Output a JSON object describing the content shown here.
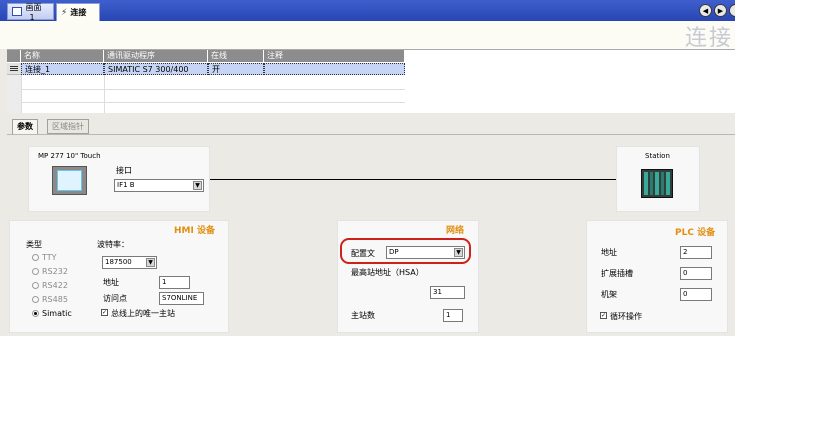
{
  "tabs": [
    {
      "label": "画面_1",
      "active": false
    },
    {
      "label": "连接",
      "active": true
    }
  ],
  "header": {
    "title": "连接"
  },
  "table": {
    "columns": [
      "名称",
      "通讯驱动程序",
      "在线",
      "注释"
    ],
    "rows": [
      {
        "name": "连接_1",
        "driver": "SIMATIC S7 300/400",
        "online": "开",
        "comment": ""
      }
    ]
  },
  "param_tabs": [
    "参数",
    "区域指针"
  ],
  "diagram": {
    "device_name": "MP 277 10\" Touch",
    "interface_label": "接口",
    "interface_value": "IF1 B",
    "station_label": "Station"
  },
  "hmi": {
    "title": "HMI 设备",
    "type_label": "类型",
    "types": [
      "TTY",
      "RS232",
      "RS422",
      "RS485",
      "Simatic"
    ],
    "selected_type": "Simatic",
    "baud_label": "波特率：",
    "baud_value": "187500",
    "address_label": "地址",
    "address_value": "1",
    "access_point_label": "访问点",
    "access_point_value": "S7ONLINE",
    "single_master_label": "总线上的唯一主站",
    "single_master_checked": true
  },
  "network": {
    "title": "网络",
    "profile_label": "配置文",
    "profile_value": "DP",
    "hsa_label": "最高站地址（HSA）",
    "hsa_value": "31",
    "master_count_label": "主站数",
    "master_count_value": "1"
  },
  "plc": {
    "title": "PLC 设备",
    "address_label": "地址",
    "address_value": "2",
    "slot_label": "扩展插槽",
    "slot_value": "0",
    "rack_label": "机架",
    "rack_value": "0",
    "cyclic_label": "循环操作",
    "cyclic_checked": true
  },
  "colors": {
    "accent": "#e28f10",
    "highlight_ring": "#d0201a",
    "tabbar": "#2f4fbf"
  }
}
